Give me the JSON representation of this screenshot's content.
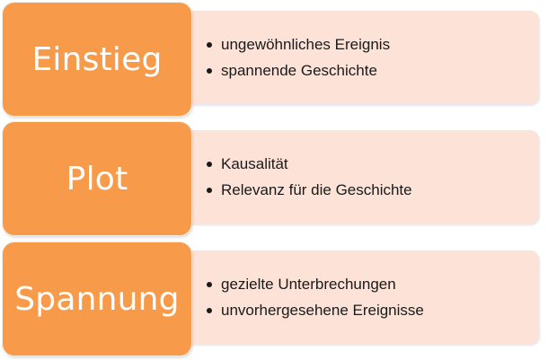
{
  "rows": [
    {
      "label": "Einstieg",
      "bullets": [
        "ungewöhnliches Ereignis",
        "spannende Geschichte"
      ]
    },
    {
      "label": "Plot",
      "bullets": [
        "Kausalität",
        "Relevanz für die Geschichte"
      ]
    },
    {
      "label": "Spannung",
      "bullets": [
        "gezielte Unterbrechungen",
        "unvorhergesehene Ereignisse"
      ]
    }
  ],
  "colors": {
    "label_fill": "#f79a4a",
    "detail_fill": "#fce2d7",
    "label_text": "#ffffff",
    "detail_text": "#1a1a1a"
  }
}
